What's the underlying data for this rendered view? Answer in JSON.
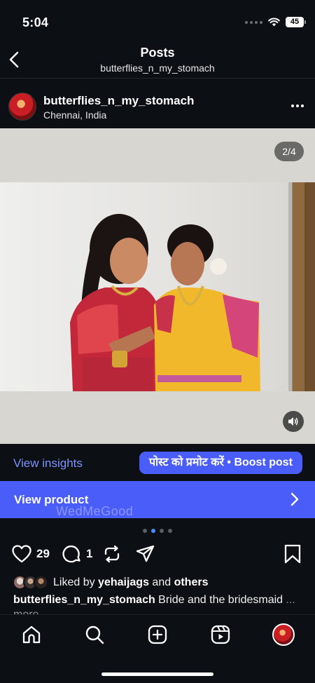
{
  "status_bar": {
    "time": "5:04",
    "battery": "45"
  },
  "header": {
    "title": "Posts",
    "subtitle": "butterflies_n_my_stomach"
  },
  "post": {
    "username": "butterflies_n_my_stomach",
    "location": "Chennai, India",
    "media_counter": "2/4",
    "carousel": {
      "total": 4,
      "active_index": 1
    }
  },
  "insights": {
    "view_insights_label": "View insights",
    "boost_label": "पोस्ट को प्रमोट करें • Boost post"
  },
  "product": {
    "label": "View product",
    "watermark": "WedMeGood"
  },
  "actions": {
    "like_count": "29",
    "comment_count": "1"
  },
  "likes": {
    "prefix": "Liked by ",
    "user": "yehaijags",
    "middle": " and ",
    "suffix": "others"
  },
  "caption": {
    "username": "butterflies_n_my_stomach",
    "text": " Bride and the bridesmaid",
    "more": "... more"
  },
  "colors": {
    "background": "#0c1014",
    "accent": "#4a5df9",
    "link": "#7b92ff"
  },
  "icons": [
    "back-chevron-icon",
    "more-dots-icon",
    "speaker-icon",
    "heart-icon",
    "comment-icon",
    "repost-icon",
    "share-icon",
    "bookmark-icon",
    "home-icon",
    "search-icon",
    "create-icon",
    "reels-icon"
  ]
}
